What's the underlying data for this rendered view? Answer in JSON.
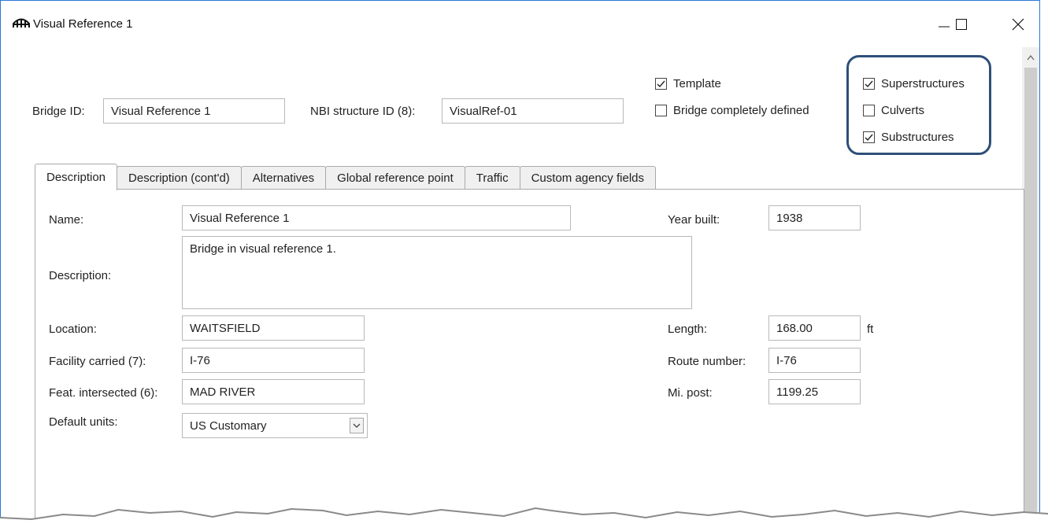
{
  "window": {
    "title": "Visual Reference 1",
    "controls": {
      "minimize": "—",
      "maximize": "☐",
      "close": "✕"
    }
  },
  "header": {
    "bridge_id_label": "Bridge ID:",
    "bridge_id_value": "Visual Reference 1",
    "nbi_label": "NBI structure ID (8):",
    "nbi_value": "VisualRef-01",
    "template_label": "Template",
    "template_checked": true,
    "completely_defined_label": "Bridge completely defined",
    "completely_defined_checked": false,
    "superstructures_label": "Superstructures",
    "superstructures_checked": true,
    "culverts_label": "Culverts",
    "culverts_checked": false,
    "substructures_label": "Substructures",
    "substructures_checked": true
  },
  "tabs": [
    {
      "label": "Description",
      "active": true
    },
    {
      "label": "Description (cont'd)",
      "active": false
    },
    {
      "label": "Alternatives",
      "active": false
    },
    {
      "label": "Global reference point",
      "active": false
    },
    {
      "label": "Traffic",
      "active": false
    },
    {
      "label": "Custom agency fields",
      "active": false
    }
  ],
  "form": {
    "name_label": "Name:",
    "name_value": "Visual Reference 1",
    "description_label": "Description:",
    "description_value": "Bridge in visual reference 1.",
    "location_label": "Location:",
    "location_value": "WAITSFIELD",
    "facility_label": "Facility carried (7):",
    "facility_value": "I-76",
    "feat_label": "Feat. intersected (6):",
    "feat_value": "MAD RIVER",
    "units_label": "Default units:",
    "units_value": "US Customary",
    "year_label": "Year built:",
    "year_value": "1938",
    "length_label": "Length:",
    "length_value": "168.00",
    "length_unit": "ft",
    "route_label": "Route number:",
    "route_value": "I-76",
    "mipost_label": "Mi. post:",
    "mipost_value": "1199.25"
  },
  "colors": {
    "window_border": "#2b78d7",
    "highlight_border": "#2e4f78"
  },
  "icons": {
    "app": "bridge-icon",
    "dropdown": "chevron-down-icon",
    "scroll_up": "chevron-up-icon"
  }
}
